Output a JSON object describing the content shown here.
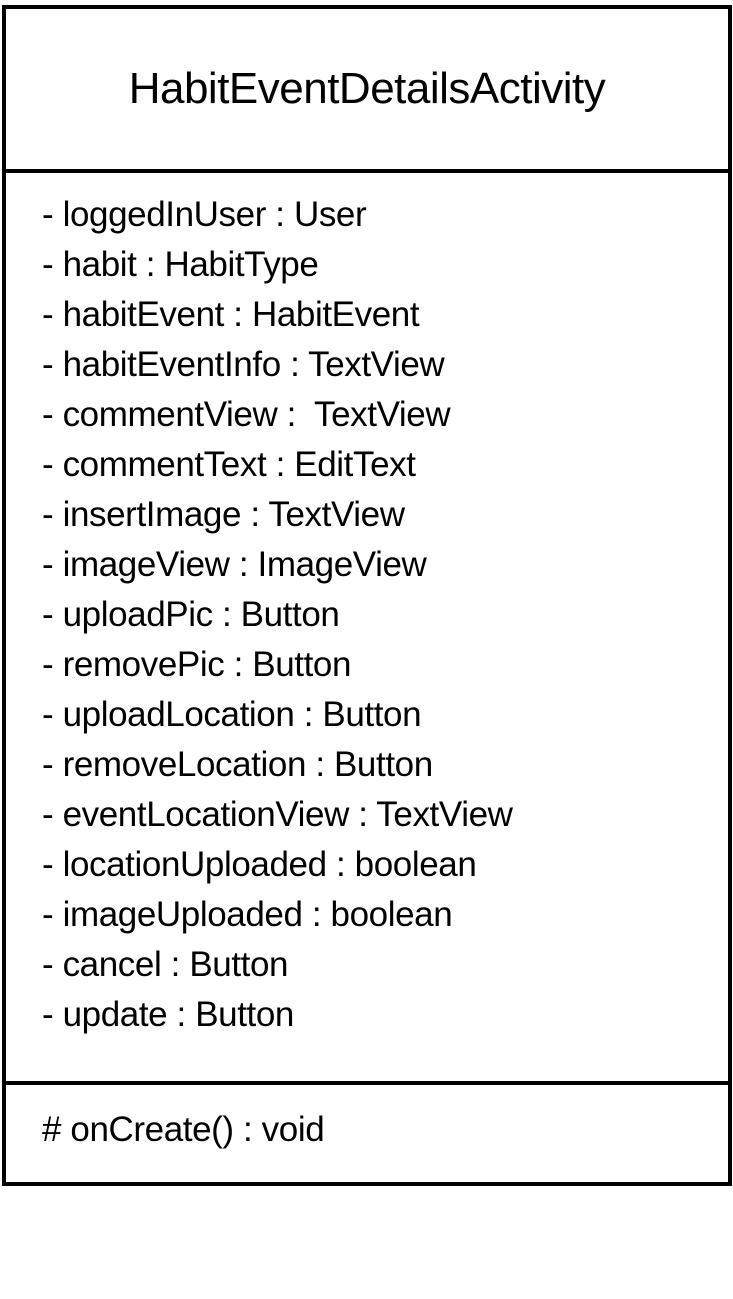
{
  "class_box": {
    "name": "HabitEventDetailsActivity",
    "attributes": [
      "- loggedInUser : User",
      "- habit : HabitType",
      "- habitEvent : HabitEvent",
      "- habitEventInfo : TextView",
      "- commentView :  TextView",
      "- commentText : EditText",
      "- insertImage : TextView",
      "- imageView : ImageView",
      "- uploadPic : Button",
      "- removePic : Button",
      "- uploadLocation : Button",
      "- removeLocation : Button",
      "- eventLocationView : TextView",
      "- locationUploaded : boolean",
      "- imageUploaded : boolean",
      "- cancel : Button",
      "- update : Button"
    ],
    "operations": [
      "# onCreate() : void"
    ]
  }
}
